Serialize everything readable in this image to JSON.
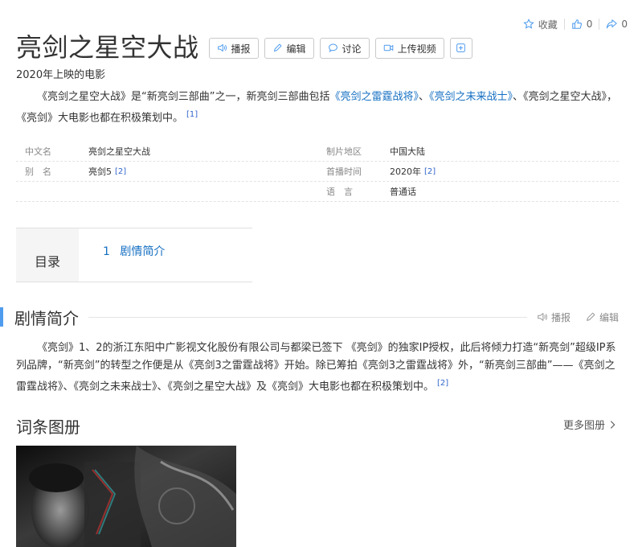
{
  "top_actions": {
    "collect": "收藏",
    "like_count": "0",
    "share_count": "0"
  },
  "title": "亮剑之星空大战",
  "toolbar": {
    "broadcast": "播报",
    "edit": "编辑",
    "discuss": "讨论",
    "upload_video": "上传视频"
  },
  "subtitle": "2020年上映的电影",
  "summary": {
    "p1": "《亮剑之星空大战》是“新亮剑三部曲”之一，新亮剑三部曲包括",
    "link1": "《亮剑之雷霆战将》",
    "p2": "、",
    "link2": "《亮剑之未来战士》",
    "p3": "、《亮剑之星空大战》，《亮剑》大电影也都在积极策划中。",
    "ref": "[1]"
  },
  "basic_info": {
    "left": [
      {
        "name": "中文名",
        "value": "亮剑之星空大战",
        "ref": ""
      },
      {
        "name": "别　名",
        "value": "亮剑5",
        "ref": "[2]"
      }
    ],
    "right": [
      {
        "name": "制片地区",
        "value": "中国大陆",
        "ref": ""
      },
      {
        "name": "首播时间",
        "value": "2020年",
        "ref": "[2]"
      },
      {
        "name": "语　言",
        "value": "普通话",
        "ref": ""
      }
    ]
  },
  "catalog": {
    "heading": "目录",
    "items": [
      {
        "num": "1",
        "label": "剧情简介"
      }
    ]
  },
  "section": {
    "title": "剧情简介",
    "broadcast": "播报",
    "edit": "编辑",
    "text": "《亮剑》1、2的浙江东阳中广影视文化股份有限公司与都梁已签下 《亮剑》的独家IP授权，此后将倾力打造“新亮剑”超级IP系列品牌，“新亮剑”的转型之作便是从《亮剑3之雷霆战将》开始。除已筹拍《亮剑3之雷霆战将》外，“新亮剑三部曲”——《亮剑之雷霆战将》、《亮剑之未来战士》、《亮剑之星空大战》及《亮剑》大电影也都在积极策划中。",
    "ref": "[2]"
  },
  "album": {
    "title": "词条图册",
    "more": "更多图册"
  },
  "colors": {
    "accent": "#4f9cee",
    "link": "#136ec2"
  }
}
